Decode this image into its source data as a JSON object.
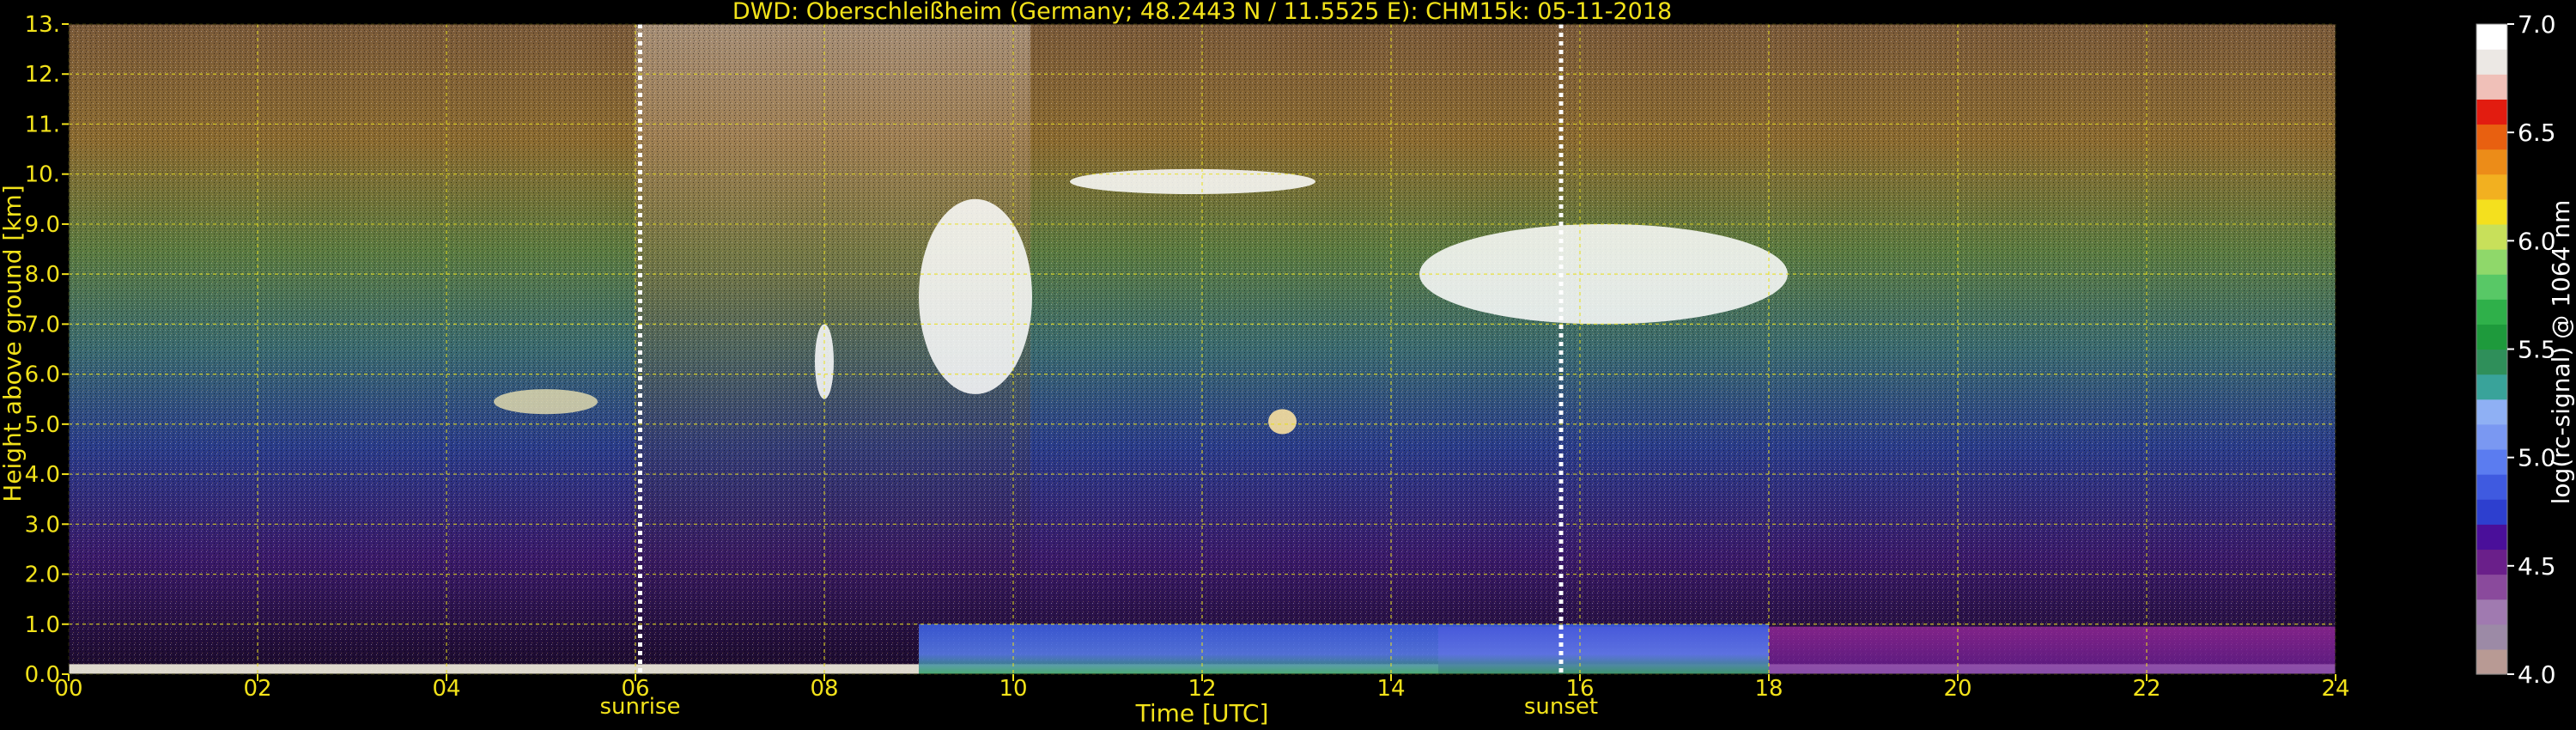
{
  "chart_data": {
    "type": "heatmap",
    "title": "DWD: Oberschleißheim (Germany; 48.2443 N / 11.5525 E):    CHM15k: 05-11-2018",
    "xlabel": "Time [UTC]",
    "ylabel": "Height above ground [km]",
    "xlim": [
      0,
      24
    ],
    "ylim": [
      0,
      13
    ],
    "x_ticks": [
      "00",
      "02",
      "04",
      "06",
      "08",
      "10",
      "12",
      "14",
      "16",
      "18",
      "20",
      "22",
      "24"
    ],
    "y_ticks": [
      "0.0",
      "1.0",
      "2.0",
      "3.0",
      "4.0",
      "5.0",
      "6.0",
      "7.0",
      "8.0",
      "9.0",
      "10.",
      "11.",
      "12.",
      "13."
    ],
    "grid": true,
    "markers": [
      {
        "label": "sunrise",
        "time": 6.05
      },
      {
        "label": "sunset",
        "time": 15.8
      }
    ],
    "colorbar": {
      "label": "log(rc-signal) @ 1064 nm",
      "min": 4.0,
      "max": 7.0,
      "ticks": [
        "4.0",
        "4.5",
        "5.0",
        "5.5",
        "6.0",
        "6.5",
        "7.0"
      ],
      "colors": [
        "#b89a94",
        "#9c8aa6",
        "#a07ab0",
        "#8a4a9c",
        "#6a1f8a",
        "#4a0f9a",
        "#2d3fcf",
        "#3f5ae0",
        "#5b7cf0",
        "#7a98f2",
        "#8fb0f4",
        "#39a39a",
        "#2f8f5a",
        "#1e9a3c",
        "#2fb04a",
        "#58c866",
        "#8fd86a",
        "#c8e05a",
        "#f4e01e",
        "#f2b020",
        "#ec8c18",
        "#e86010",
        "#e21c10",
        "#f0c0b8",
        "#ece8e4",
        "#ffffff"
      ]
    },
    "features": [
      {
        "name": "surface_layer",
        "time": [
          0,
          24
        ],
        "height": [
          0,
          0.2
        ]
      },
      {
        "name": "boundary_layer",
        "time": [
          9,
          18
        ],
        "height": [
          0,
          1.0
        ]
      },
      {
        "name": "cloud_a",
        "time": [
          4.5,
          5.6
        ],
        "height": [
          5.2,
          5.7
        ]
      },
      {
        "name": "cloud_b",
        "time": [
          7.9,
          8.1
        ],
        "height": [
          5.5,
          7.0
        ]
      },
      {
        "name": "cloud_c",
        "time": [
          9.0,
          10.2
        ],
        "height": [
          5.6,
          9.5
        ]
      },
      {
        "name": "cloud_d",
        "time": [
          10.6,
          13.2
        ],
        "height": [
          9.6,
          10.1
        ]
      },
      {
        "name": "cloud_e",
        "time": [
          12.7,
          13.0
        ],
        "height": [
          4.8,
          5.3
        ]
      },
      {
        "name": "cloud_f",
        "time": [
          14.3,
          18.2
        ],
        "height": [
          7.0,
          9.0
        ]
      }
    ]
  }
}
